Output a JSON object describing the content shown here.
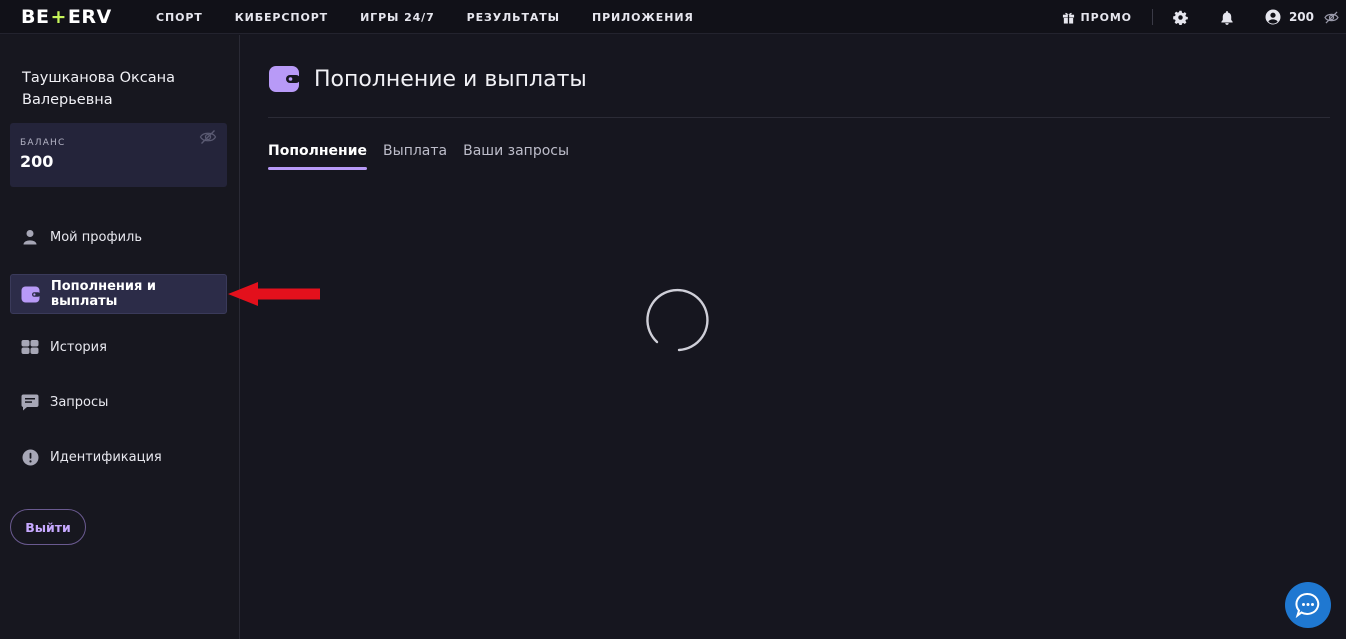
{
  "header": {
    "logo": {
      "left": "BE",
      "plus": "+",
      "right": "ERV"
    },
    "nav": [
      "СПОРТ",
      "КИБЕРСПОРТ",
      "ИГРЫ 24/7",
      "РЕЗУЛЬТАТЫ",
      "ПРИЛОЖЕНИЯ"
    ],
    "promo_label": "ПРОМО",
    "balance": "200"
  },
  "sidebar": {
    "user_name": "Таушканова Оксана Валерьевна",
    "balance_label": "БАЛАНС",
    "balance_value": "200",
    "items": [
      {
        "label": "Мой профиль",
        "icon": "user-icon",
        "active": false
      },
      {
        "label": "Пополнения и выплаты",
        "icon": "wallet-icon",
        "active": true
      },
      {
        "label": "История",
        "icon": "history-icon",
        "active": false
      },
      {
        "label": "Запросы",
        "icon": "message-icon",
        "active": false
      },
      {
        "label": "Идентификация",
        "icon": "alert-icon",
        "active": false
      }
    ],
    "logout_label": "Выйти"
  },
  "main": {
    "title": "Пополнение и выплаты",
    "tabs": [
      {
        "label": "Пополнение",
        "active": true
      },
      {
        "label": "Выплата",
        "active": false
      },
      {
        "label": "Ваши запросы",
        "active": false
      }
    ],
    "loading": true
  },
  "colors": {
    "accent": "#b89af7",
    "background": "#16161f",
    "sidebar": "#17171f",
    "active_item": "#2c2c48",
    "chat_button": "#1f78d1",
    "annotation_arrow": "#e3101c",
    "logo_plus": "#c6f55a"
  }
}
